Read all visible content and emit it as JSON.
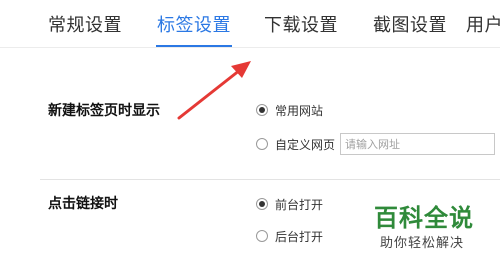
{
  "tabs": [
    {
      "label": "常规设置"
    },
    {
      "label": "标签设置"
    },
    {
      "label": "下载设置"
    },
    {
      "label": "截图设置"
    },
    {
      "label": "用户"
    }
  ],
  "active_tab": "标签设置",
  "accent_color": "#2b78e4",
  "new_tab": {
    "title": "新建标签页时显示",
    "options": [
      {
        "label": "常用网站",
        "checked": true
      },
      {
        "label": "自定义网页",
        "checked": false
      }
    ],
    "url_placeholder": "请输入网址",
    "url_value": ""
  },
  "link_click": {
    "title": "点击链接时",
    "options": [
      {
        "label": "前台打开",
        "checked": true
      },
      {
        "label": "后台打开",
        "checked": false
      }
    ]
  },
  "annotation": {
    "icon": "red-arrow-icon",
    "color": "#e53935"
  },
  "watermark": {
    "title": "百科全说",
    "subtitle": "助你轻松解决"
  }
}
